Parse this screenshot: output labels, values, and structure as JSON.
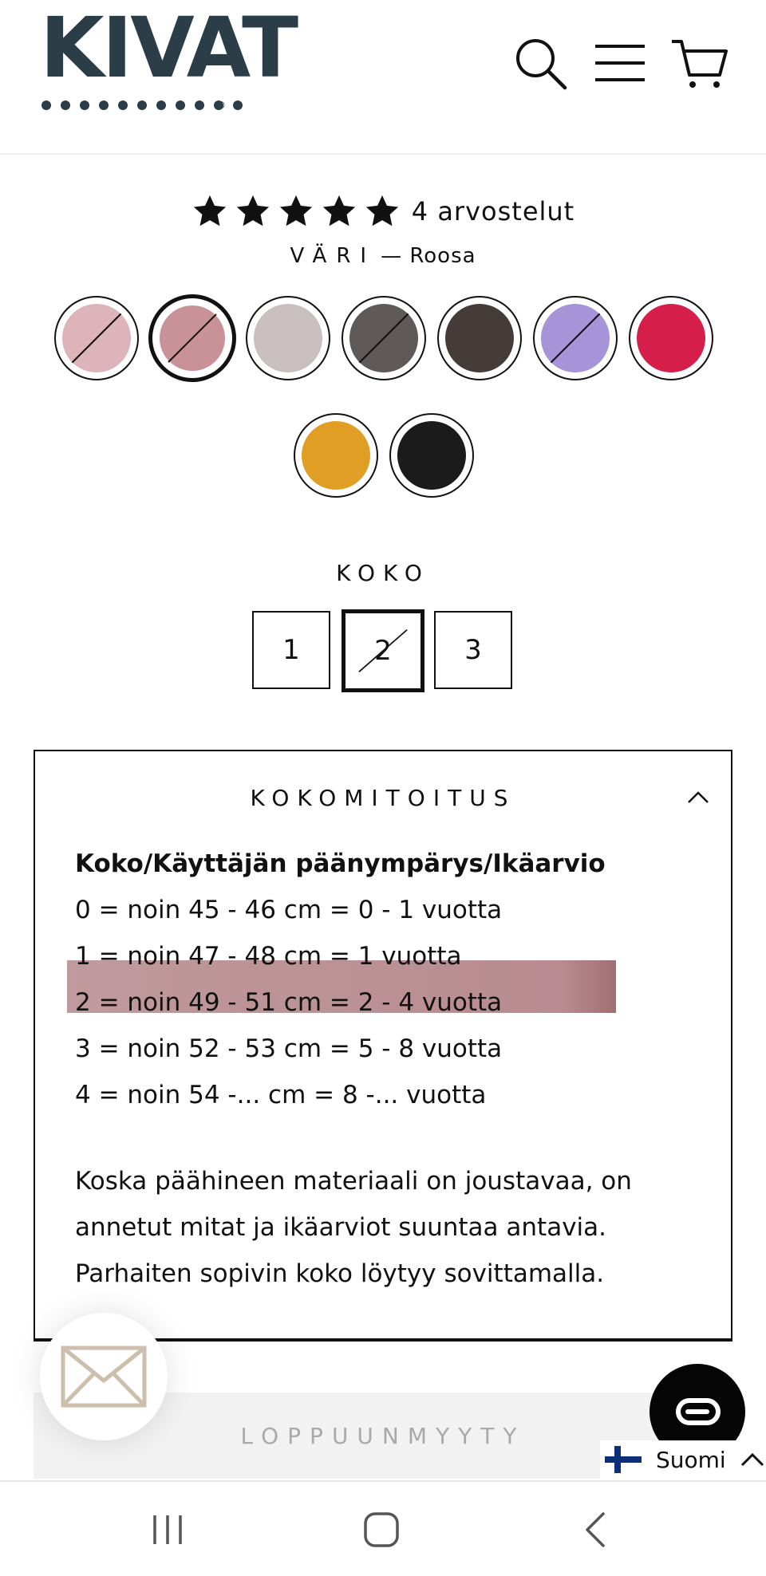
{
  "header": {
    "logo_text": "KIVAT",
    "logo_mark": "®",
    "icons": [
      "search-icon",
      "menu-icon",
      "cart-icon"
    ]
  },
  "product": {
    "rating": {
      "stars": 5,
      "reviews_label": "4 arvostelut"
    },
    "color": {
      "label": "VÄRI",
      "value": "— Roosa",
      "swatches": [
        {
          "color": "#dcb4b9",
          "sold_out": true,
          "selected": false
        },
        {
          "color": "#c99299",
          "sold_out": true,
          "selected": true
        },
        {
          "color": "#c9bfbf",
          "sold_out": false,
          "selected": false
        },
        {
          "color": "#5f5a58",
          "sold_out": true,
          "selected": false
        },
        {
          "color": "#453c3a",
          "sold_out": false,
          "selected": false
        },
        {
          "color": "#a793d8",
          "sold_out": true,
          "selected": false
        },
        {
          "color": "#d51f4a",
          "sold_out": false,
          "selected": false
        },
        {
          "color": "#e09f24",
          "sold_out": false,
          "selected": false
        },
        {
          "color": "#1b1b1b",
          "sold_out": false,
          "selected": false
        }
      ]
    },
    "size": {
      "label": "KOKO",
      "options": [
        {
          "label": "1",
          "sold_out": false,
          "selected": false
        },
        {
          "label": "2",
          "sold_out": true,
          "selected": true
        },
        {
          "label": "3",
          "sold_out": false,
          "selected": false
        }
      ]
    },
    "size_guide": {
      "title": "KOKOMITOITUS",
      "heading": "Koko/Käyttäjän päänympärys/Ikäarvio",
      "rows": [
        "0 = noin 45 - 46 cm = 0 - 1 vuotta",
        "1 = noin 47 - 48 cm = 1 vuotta",
        "2 = noin 49 - 51 cm = 2 - 4 vuotta",
        "3 = noin 52 - 53 cm = 5 - 8 vuotta",
        "4 = noin 54 -... cm = 8 -... vuotta"
      ],
      "highlighted_row": 2,
      "note": "Koska päähineen materiaali on joustavaa, on annetut mitat ja ikäarviot suuntaa antavia. Parhaiten sopivin koko löytyy sovittamalla."
    },
    "sold_out_label": "LOPPUUNMYYTY"
  },
  "floating": {
    "language": "Suomi",
    "icons": [
      "mail-icon",
      "chat-icon",
      "finland-flag-icon"
    ]
  },
  "system_nav": {
    "icons": [
      "recent-apps-icon",
      "home-icon",
      "back-icon"
    ]
  }
}
